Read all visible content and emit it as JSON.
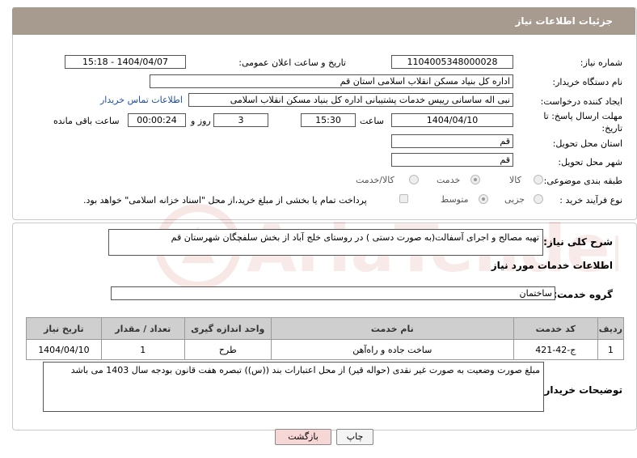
{
  "header": {
    "title": "جزئیات اطلاعات نیاز"
  },
  "form": {
    "need_number_label": "شماره نیاز:",
    "need_number": "1104005348000028",
    "announce_label": "تاریخ و ساعت اعلان عمومی:",
    "announce_value": "1404/04/07 - 15:18",
    "buyer_label": "نام دستگاه خریدار:",
    "buyer_value": "اداره کل بنیاد مسکن انقلاب اسلامی استان قم",
    "creator_label": "ایجاد کننده درخواست:",
    "creator_value": "نبی اله ساسانی رییس خدمات پشتیبانی اداره کل بنیاد مسکن انقلاب اسلامی",
    "contact_link": "اطلاعات تماس خریدار",
    "deadline_label_1": "مهلت ارسال پاسخ: تا",
    "deadline_label_2": "تاریخ:",
    "deadline_date": "1404/04/10",
    "time_label": "ساعت",
    "deadline_time": "15:30",
    "days_value": "3",
    "days_label": "روز و",
    "remaining_time": "00:00:24",
    "remaining_label": "ساعت باقی مانده",
    "province_label": "استان محل تحویل:",
    "province_value": "قم",
    "city_label": "شهر محل تحویل:",
    "city_value": "قم",
    "category_label": "طبقه بندی موضوعی:",
    "category_options": [
      "کالا",
      "خدمت",
      "کالا/خدمت"
    ],
    "category_selected": "خدمت",
    "process_label": "نوع فرآیند خرید :",
    "process_options": [
      "جزیی",
      "متوسط"
    ],
    "process_selected": "متوسط",
    "payment_note": "پرداخت تمام یا بخشی از مبلغ خرید،از محل \"اسناد خزانه اسلامی\" خواهد بود."
  },
  "summary": {
    "label": "شرح کلی نیاز:",
    "value": "تهیه مصالح و اجرای آسفالت(به صورت دستی ) در روستای خلج آباد از بخش سلفچگان شهرستان قم"
  },
  "services": {
    "section_title": "اطلاعات خدمات مورد نیاز",
    "group_label": "گروه خدمت:",
    "group_value": "ساختمان",
    "columns": [
      "ردیف",
      "کد خدمت",
      "نام خدمت",
      "واحد اندازه گیری",
      "تعداد / مقدار",
      "تاریخ نیاز"
    ],
    "rows": [
      [
        "1",
        "ج-42-421",
        "ساخت جاده و راه‌آهن",
        "طرح",
        "1",
        "1404/04/10"
      ]
    ]
  },
  "buyer_notes": {
    "label": "توضیحات خریدار:",
    "value": "مبلغ صورت وضعیت به صورت غیر نقدی  (حواله قیر) از محل اعتبارات بند ((س)) تبصره هفت  قانون بودجه سال 1403 می باشد"
  },
  "buttons": {
    "print": "چاپ",
    "back": "بازگشت"
  },
  "watermark": {
    "text": "AriaTender.neT"
  },
  "colors": {
    "header_bg": "#a79b8f",
    "link": "#1d4fa3",
    "back_button_bg": "#f7d6d6"
  }
}
